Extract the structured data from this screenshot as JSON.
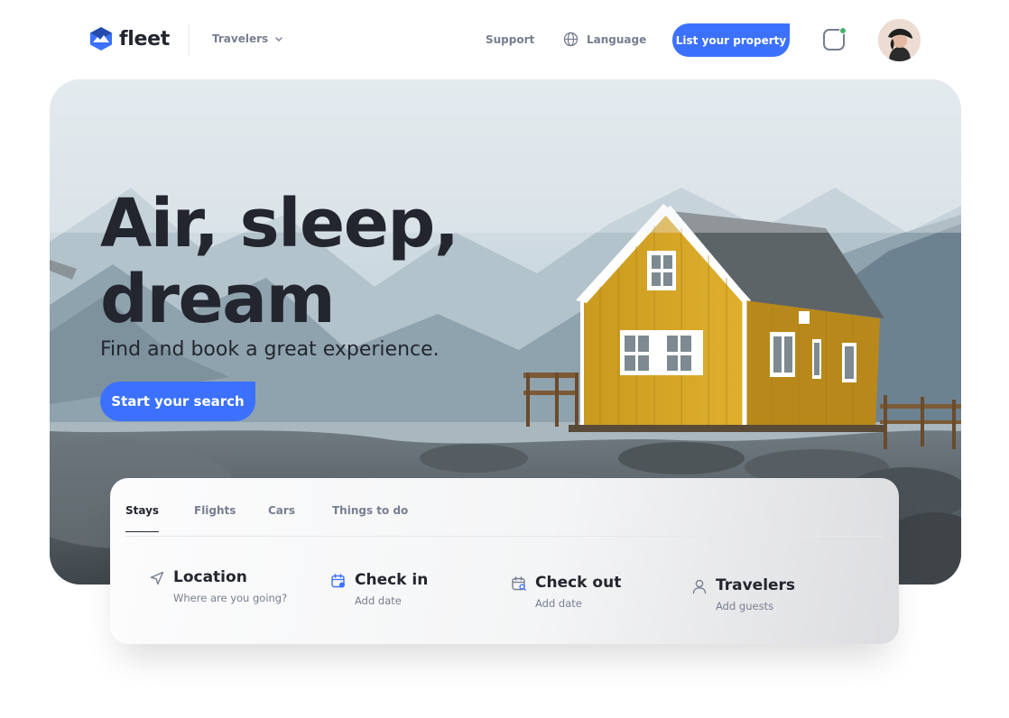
{
  "header": {
    "brand": "fleet",
    "menu_label": "Travelers",
    "support": "Support",
    "language": "Language",
    "cta": "List your property",
    "colors": {
      "accent": "#3b71fe",
      "notification": "#45b26b"
    }
  },
  "hero": {
    "title": "Air, sleep, dream",
    "subtitle": "Find and book a great experience.",
    "button": "Start your search"
  },
  "search": {
    "tabs": [
      "Stays",
      "Flights",
      "Cars",
      "Things to do"
    ],
    "active_tab": "Stays",
    "fields": [
      {
        "icon": "location-icon",
        "label": "Location",
        "hint": "Where are you going?"
      },
      {
        "icon": "calendar-icon",
        "label": "Check in",
        "hint": "Add date"
      },
      {
        "icon": "calendar-search-icon",
        "label": "Check out",
        "hint": "Add date"
      },
      {
        "icon": "user-icon",
        "label": "Travelers",
        "hint": "Add guests"
      }
    ]
  }
}
